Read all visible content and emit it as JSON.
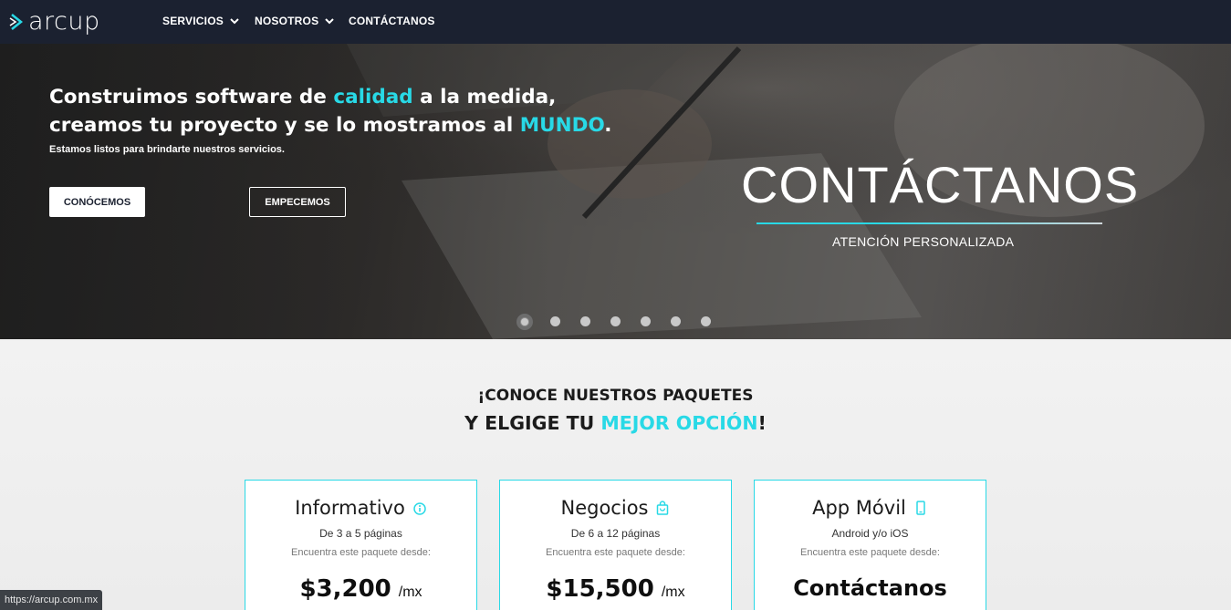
{
  "brand": {
    "logo_text": "arcup",
    "accent": "#28d9e6",
    "nav_bg": "#1b2130"
  },
  "nav": {
    "items": [
      {
        "label": "SERVICIOS",
        "has_dropdown": true
      },
      {
        "label": "NOSOTROS",
        "has_dropdown": true
      },
      {
        "label": "CONTÁCTANOS",
        "has_dropdown": false
      }
    ]
  },
  "hero": {
    "title_part1": "Construimos software de ",
    "title_hl1": "calidad",
    "title_part2": " a la medida, creamos tu proyecto y se lo mostramos al ",
    "title_hl2": "MUNDO",
    "title_part3": ".",
    "subtitle": "Estamos listos para brindarte nuestros servicios.",
    "btn_primary": "CONÓCEMOS",
    "btn_secondary": "EMPECEMOS",
    "slide_heading": "CONTÁCTANOS",
    "slide_sub": "ATENCIÓN PERSONALIZADA",
    "carousel": {
      "total": 7,
      "active_index": 0
    }
  },
  "packages": {
    "line1": "¡CONOCE NUESTROS PAQUETES",
    "line2_a": "Y ELGIGE TU ",
    "line2_hl": "MEJOR OPCIÓN",
    "line2_b": "!",
    "cards": [
      {
        "title": "Informativo",
        "icon": "info-circle-icon",
        "pages": "De 3 a 5 páginas",
        "find": "Encuentra este paquete desde:",
        "price": "$3,200",
        "per": "/mx"
      },
      {
        "title": "Negocios",
        "icon": "shopping-bag-icon",
        "pages": "De 6 a 12 páginas",
        "find": "Encuentra este paquete desde:",
        "price": "$15,500",
        "per": "/mx"
      },
      {
        "title": "App Móvil",
        "icon": "mobile-phone-icon",
        "pages": "Android y/o iOS",
        "find": "Encuentra este paquete desde:",
        "price": "Contáctanos"
      }
    ]
  },
  "status_url": "https://arcup.com.mx"
}
